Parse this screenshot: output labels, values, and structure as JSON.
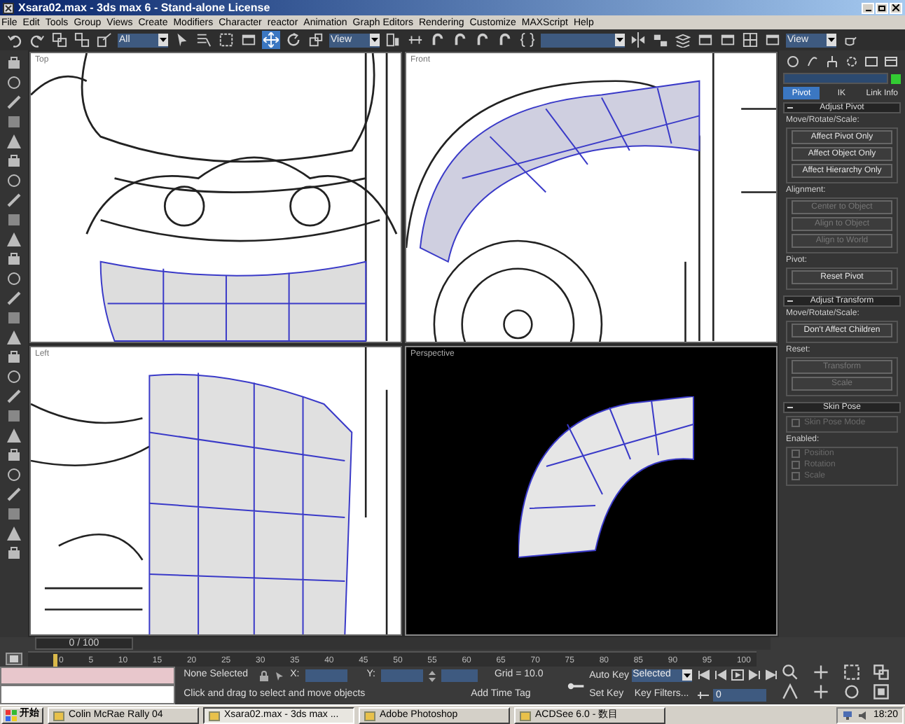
{
  "window": {
    "title": "Xsara02.max - 3ds max 6 - Stand-alone License"
  },
  "menu": [
    "File",
    "Edit",
    "Tools",
    "Group",
    "Views",
    "Create",
    "Modifiers",
    "Character",
    "reactor",
    "Animation",
    "Graph Editors",
    "Rendering",
    "Customize",
    "MAXScript",
    "Help"
  ],
  "toolbar": [
    {
      "kind": "undo",
      "selected": false
    },
    {
      "kind": "redo",
      "selected": false
    },
    {
      "kind": "link",
      "selected": false
    },
    {
      "kind": "unlink",
      "selected": false
    },
    {
      "kind": "bind",
      "selected": false
    },
    {
      "kind": "dropdown",
      "value": "All"
    },
    {
      "kind": "cursor",
      "selected": false
    },
    {
      "kind": "list",
      "selected": false
    },
    {
      "kind": "region",
      "selected": false
    },
    {
      "kind": "window",
      "selected": false
    },
    {
      "kind": "move",
      "selected": true
    },
    {
      "kind": "rotate",
      "selected": false
    },
    {
      "kind": "scale",
      "selected": false
    },
    {
      "kind": "dropdown",
      "value": "View"
    },
    {
      "kind": "pivot",
      "selected": false
    },
    {
      "kind": "manipulate",
      "selected": false
    },
    {
      "kind": "snap",
      "selected": false
    },
    {
      "kind": "snap",
      "selected": false
    },
    {
      "kind": "snap",
      "selected": false
    },
    {
      "kind": "snap",
      "selected": false
    },
    {
      "kind": "braces",
      "selected": false
    },
    {
      "kind": "dropdown"
    },
    {
      "kind": "mirror",
      "selected": false
    },
    {
      "kind": "align",
      "selected": false
    },
    {
      "kind": "layers",
      "selected": false
    },
    {
      "kind": "window",
      "selected": false
    },
    {
      "kind": "window",
      "selected": false
    },
    {
      "kind": "grid",
      "selected": false
    },
    {
      "kind": "window",
      "selected": false
    },
    {
      "kind": "dropdown",
      "value": "View"
    },
    {
      "kind": "teapot",
      "selected": false
    }
  ],
  "viewports": [
    {
      "label": "Top",
      "kind": "top"
    },
    {
      "label": "Front",
      "kind": "front"
    },
    {
      "label": "Left",
      "kind": "left"
    },
    {
      "label": "Perspective",
      "kind": "perspective"
    }
  ],
  "command_panel": {
    "tabs": [
      {
        "label": "Pivot",
        "selected": true
      },
      {
        "label": "IK",
        "selected": false
      },
      {
        "label": "Link Info",
        "selected": false
      }
    ],
    "rollouts": [
      {
        "title": "Adjust Pivot",
        "groups": [
          {
            "label": "Move/Rotate/Scale:",
            "items": [
              {
                "kind": "button",
                "label": "Affect Pivot Only",
                "disabled": false
              },
              {
                "kind": "button",
                "label": "Affect Object Only",
                "disabled": false
              },
              {
                "kind": "button",
                "label": "Affect Hierarchy Only",
                "disabled": false
              }
            ]
          },
          {
            "label": "Alignment:",
            "items": [
              {
                "kind": "button",
                "label": "Center to Object",
                "disabled": true
              },
              {
                "kind": "button",
                "label": "Align to Object",
                "disabled": true
              },
              {
                "kind": "button",
                "label": "Align to World",
                "disabled": true
              }
            ]
          },
          {
            "label": "Pivot:",
            "items": [
              {
                "kind": "button",
                "label": "Reset Pivot",
                "disabled": false
              }
            ]
          }
        ]
      },
      {
        "title": "Adjust Transform",
        "groups": [
          {
            "label": "Move/Rotate/Scale:",
            "items": [
              {
                "kind": "button",
                "label": "Don't Affect Children",
                "disabled": false
              }
            ]
          },
          {
            "label": "Reset:",
            "items": [
              {
                "kind": "button",
                "label": "Transform",
                "disabled": true
              },
              {
                "kind": "button",
                "label": "Scale",
                "disabled": true
              }
            ]
          }
        ]
      },
      {
        "title": "Skin Pose",
        "groups": [
          {
            "items": [
              {
                "kind": "checkbox",
                "label": "Skin Pose Mode",
                "checked": false,
                "disabled": true
              }
            ]
          },
          {
            "label": "Enabled:",
            "items": [
              {
                "kind": "checkbox",
                "label": "Position",
                "checked": false,
                "disabled": true
              },
              {
                "kind": "checkbox",
                "label": "Rotation",
                "checked": false,
                "disabled": true
              },
              {
                "kind": "checkbox",
                "label": "Scale",
                "checked": false,
                "disabled": true
              }
            ]
          }
        ]
      }
    ]
  },
  "timeline": {
    "frame": "0 / 100",
    "level": 0,
    "ticks": [
      "0",
      "5",
      "10",
      "15",
      "20",
      "25",
      "30",
      "35",
      "40",
      "45",
      "50",
      "55",
      "60",
      "65",
      "70",
      "75",
      "80",
      "85",
      "90",
      "95",
      "100"
    ]
  },
  "status": {
    "selection": "None Selected",
    "prompt": "Click and drag to select and move objects",
    "x_label": "X:",
    "y_label": "Y:",
    "grid": "Grid = 10.0",
    "time_tag": "Add Time Tag",
    "auto_key": "Auto Key",
    "set_key": "Set Key",
    "key_mode": "Selected",
    "key_filters": "Key Filters...",
    "current_frame": "0"
  },
  "taskbar": {
    "start": "开始",
    "items": [
      {
        "label": "Colin McRae Rally 04",
        "selected": false
      },
      {
        "label": "Xsara02.max - 3ds max ...",
        "selected": true
      },
      {
        "label": "Adobe Photoshop",
        "selected": false
      },
      {
        "label": "ACDSee 6.0 - 数目",
        "selected": false
      }
    ],
    "clock": "18:20"
  }
}
